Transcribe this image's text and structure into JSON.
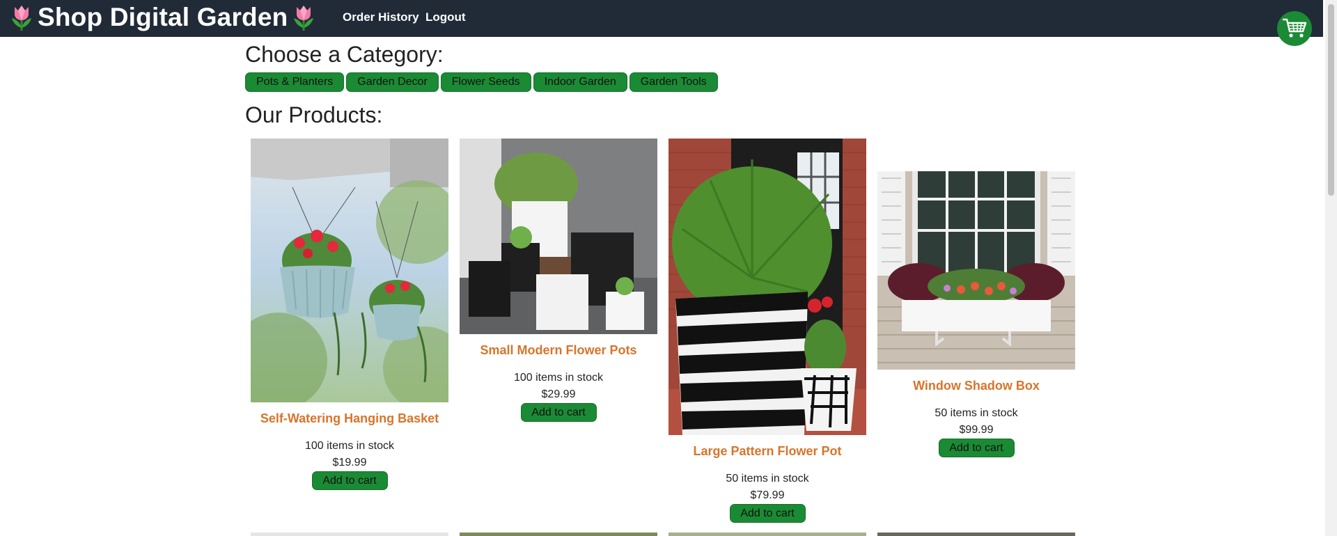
{
  "brand": {
    "title": "Shop Digital Garden"
  },
  "nav": {
    "order_history": "Order History",
    "logout": "Logout"
  },
  "headings": {
    "category": "Choose a Category:",
    "products": "Our Products:"
  },
  "categories": [
    "Pots & Planters",
    "Garden Decor",
    "Flower Seeds",
    "Indoor Garden",
    "Garden Tools"
  ],
  "products": [
    {
      "name": "Self-Watering Hanging Basket",
      "stock": "100 items in stock",
      "price": "$19.99",
      "button": "Add to cart"
    },
    {
      "name": "Small Modern Flower Pots",
      "stock": "100 items in stock",
      "price": "$29.99",
      "button": "Add to cart"
    },
    {
      "name": "Large Pattern Flower Pot",
      "stock": "50 items in stock",
      "price": "$79.99",
      "button": "Add to cart"
    },
    {
      "name": "Window Shadow Box",
      "stock": "50 items in stock",
      "price": "$99.99",
      "button": "Add to cart"
    }
  ],
  "colors": {
    "navbar": "#212b38",
    "accent_green": "#1b8a35",
    "product_name": "#d8742a"
  },
  "icons": {
    "brand": "tulip-icon",
    "cart": "shopping-cart-icon"
  }
}
